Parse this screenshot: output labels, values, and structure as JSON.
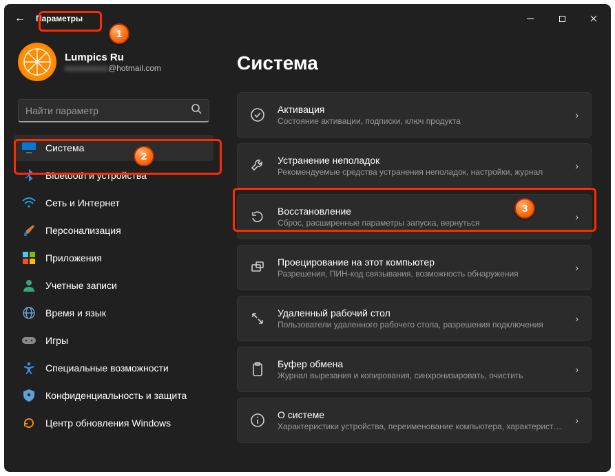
{
  "window": {
    "app_title": "Параметры",
    "controls": {
      "min": "—",
      "max": "▢",
      "close": "✕"
    },
    "back_glyph": "←"
  },
  "profile": {
    "name": "Lumpics Ru",
    "email_visible": "@hotmail.com"
  },
  "search": {
    "placeholder": "Найти параметр"
  },
  "sidebar": {
    "items": [
      {
        "icon": "monitor-icon",
        "label": "Система",
        "selected": true
      },
      {
        "icon": "bluetooth-icon",
        "label": "Bluetooth и устройства"
      },
      {
        "icon": "wifi-icon",
        "label": "Сеть и Интернет"
      },
      {
        "icon": "brush-icon",
        "label": "Персонализация"
      },
      {
        "icon": "apps-icon",
        "label": "Приложения"
      },
      {
        "icon": "person-icon",
        "label": "Учетные записи"
      },
      {
        "icon": "globe-clock-icon",
        "label": "Время и язык"
      },
      {
        "icon": "gamepad-icon",
        "label": "Игры"
      },
      {
        "icon": "accessibility-icon",
        "label": "Специальные возможности"
      },
      {
        "icon": "shield-icon",
        "label": "Конфиденциальность и защита"
      },
      {
        "icon": "windows-update-icon",
        "label": "Центр обновления Windows"
      }
    ]
  },
  "main": {
    "title": "Система",
    "cards": [
      {
        "icon": "check-circle-icon",
        "title": "Активация",
        "desc": "Состояние активации, подписки, ключ продукта"
      },
      {
        "icon": "wrench-icon",
        "title": "Устранение неполадок",
        "desc": "Рекомендуемые средства устранения неполадок, настройки, журнал"
      },
      {
        "icon": "recovery-icon",
        "title": "Восстановление",
        "desc": "Сброс, расширенные параметры запуска, вернуться"
      },
      {
        "icon": "project-icon",
        "title": "Проецирование на этот компьютер",
        "desc": "Разрешения, ПИН-код связывания, возможность обнаружения"
      },
      {
        "icon": "remote-icon",
        "title": "Удаленный рабочий стол",
        "desc": "Пользователи удаленного рабочего стола, разрешения подключения"
      },
      {
        "icon": "clipboard-icon",
        "title": "Буфер обмена",
        "desc": "Журнал вырезания и копирования, синхронизировать, очистить"
      },
      {
        "icon": "info-icon",
        "title": "О системе",
        "desc": "Характеристики устройства, переименование компьютера, характеристики Windows"
      }
    ]
  },
  "annotations": {
    "badges": [
      "1",
      "2",
      "3"
    ]
  },
  "colors": {
    "bg": "#202020",
    "card": "#2b2b2b",
    "accent": "#4cc2ff",
    "anno": "#ff2a00"
  }
}
